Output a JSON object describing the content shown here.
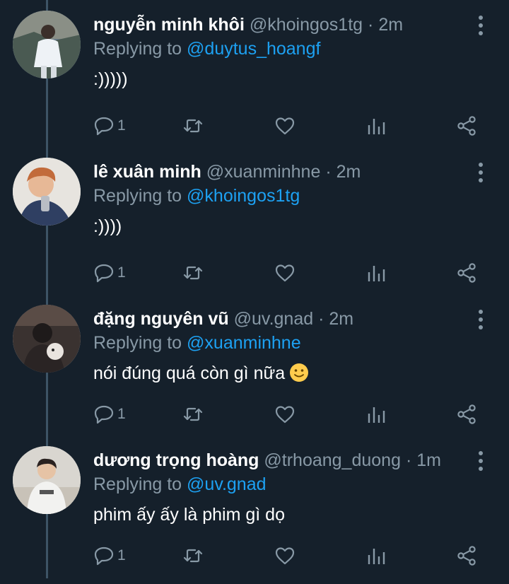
{
  "colors": {
    "background": "#15202b",
    "secondary_text": "#8899a6",
    "mention": "#1da1f2",
    "thread_line": "#3d5466"
  },
  "reply_prefix": "Replying to",
  "tweets": [
    {
      "name": "nguyễn minh khôi",
      "handle": "@khoingos1tg",
      "separator": "·",
      "time": "2m",
      "reply_to": "@duytus_hoangf",
      "text": ":)))))",
      "reply_count": "1",
      "emoji": ""
    },
    {
      "name": "lê xuân minh",
      "handle": "@xuanminhne",
      "separator": "·",
      "time": "2m",
      "reply_to": "@khoingos1tg",
      "text": ":))))",
      "reply_count": "1",
      "emoji": ""
    },
    {
      "name": "đặng nguyên vũ",
      "handle": "@uv.gnad",
      "separator": "·",
      "time": "2m",
      "reply_to": "@xuanminhne",
      "text": "nói đúng quá còn gì nữa",
      "reply_count": "1",
      "emoji": "slightly-smiling-face"
    },
    {
      "name": "dương trọng hoàng",
      "handle": "@trhoang_duong",
      "separator": "·",
      "time": "1m",
      "reply_to": "@uv.gnad",
      "text": "phim ấy ấy là phim gì dọ",
      "reply_count": "1",
      "emoji": ""
    }
  ]
}
